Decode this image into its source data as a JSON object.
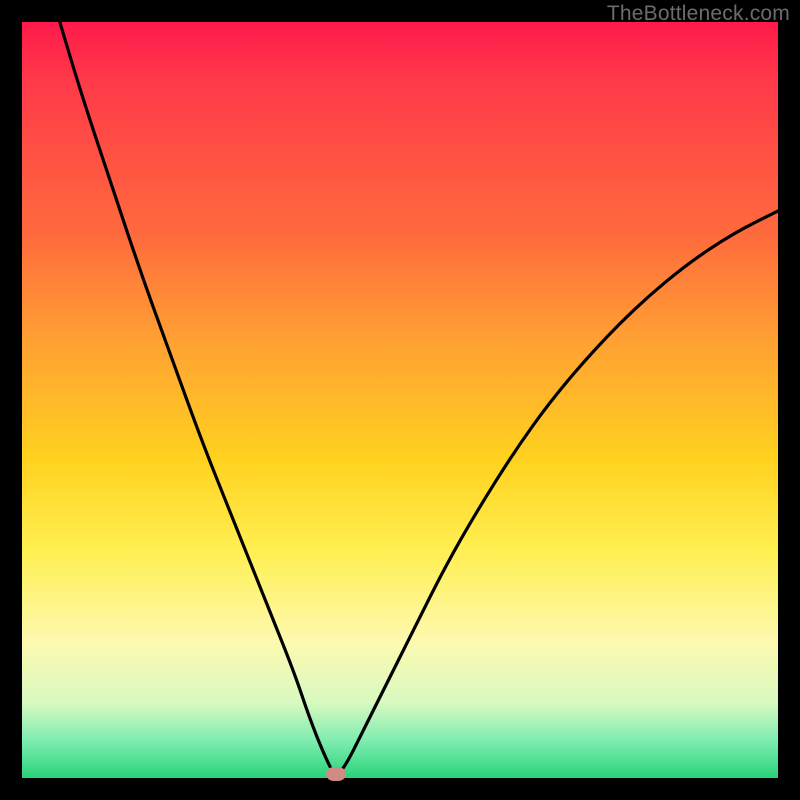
{
  "watermark": "TheBottleneck.com",
  "colors": {
    "frame": "#000000",
    "curve": "#000000",
    "marker": "#cf8b85",
    "gradient_stops": [
      "#ff1a4b",
      "#ff3a4a",
      "#ff6a3d",
      "#ffa033",
      "#ffd21f",
      "#ffef52",
      "#fdf9b0",
      "#d8f9c0",
      "#7fedb0",
      "#29d37a"
    ]
  },
  "chart_data": {
    "type": "line",
    "title": "",
    "xlabel": "",
    "ylabel": "",
    "xlim": [
      0,
      100
    ],
    "ylim": [
      0,
      100
    ],
    "note": "Axes are unitless; values estimated from pixels. V-shaped bottleneck curve with minimum at ≈ (41.5, 0). Left branch starts near top-left, right branch rises toward upper-right.",
    "series": [
      {
        "name": "bottleneck-curve",
        "x": [
          5,
          8,
          12,
          16,
          20,
          24,
          28,
          32,
          36,
          38,
          40,
          41.5,
          43,
          45,
          48,
          52,
          56,
          60,
          65,
          70,
          76,
          82,
          88,
          94,
          100
        ],
        "y": [
          100,
          90,
          78,
          66,
          55,
          44,
          34,
          24,
          14,
          8,
          3,
          0,
          2,
          6,
          12,
          20,
          28,
          35,
          43,
          50,
          57,
          63,
          68,
          72,
          75
        ]
      }
    ],
    "marker": {
      "x": 41.5,
      "y": 0
    }
  }
}
